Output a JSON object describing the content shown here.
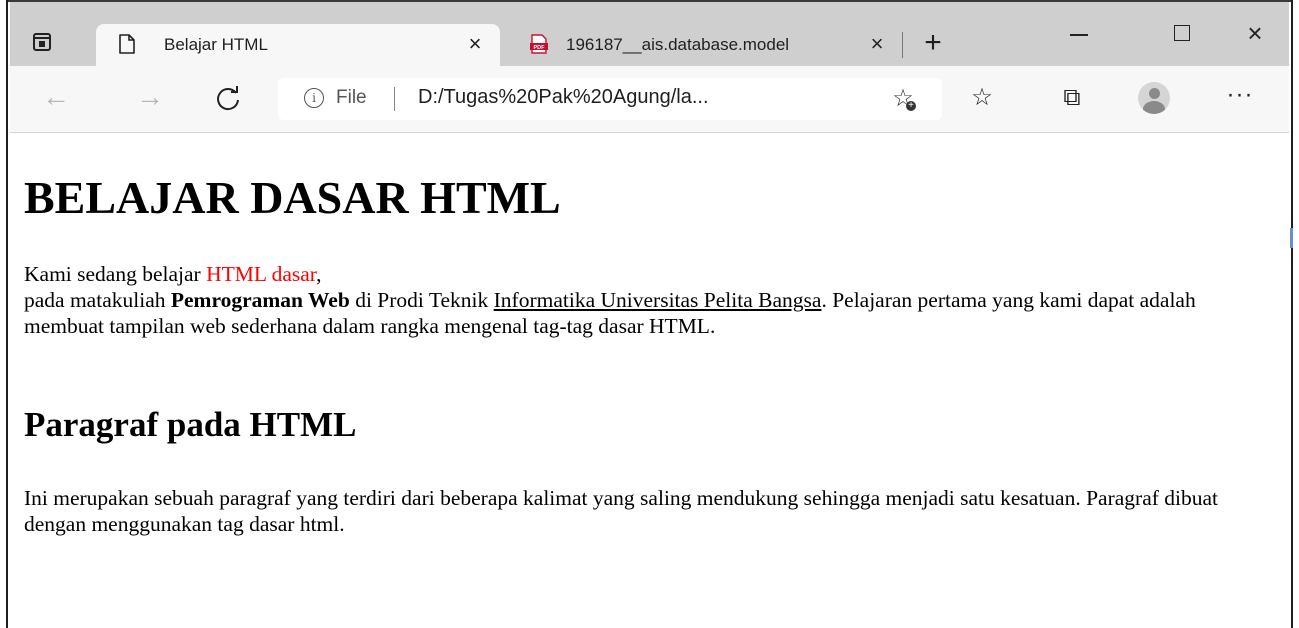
{
  "browser": {
    "tabs": [
      {
        "title": "Belajar HTML",
        "active": true,
        "icon": "page-icon"
      },
      {
        "title": "196187__ais.database.model",
        "active": false,
        "icon": "pdf-icon"
      }
    ],
    "tab_close_glyph": "×",
    "new_tab_glyph": "+",
    "window_close_glyph": "×",
    "address": {
      "info_glyph": "i",
      "scheme_label": "File",
      "url": "D:/Tugas%20Pak%20Agung/la..."
    },
    "nav": {
      "back": "←",
      "forward": "→",
      "reload": "C"
    },
    "toolbar": {
      "favorites_glyph": "☆",
      "collections_glyph": "⧉",
      "more_glyph": "···"
    }
  },
  "page": {
    "heading": "BELAJAR DASAR HTML",
    "intro": {
      "line1_prefix": "Kami sedang belajar ",
      "line1_highlight": "HTML dasar",
      "line1_suffix": ",",
      "line2_prefix": "pada matakuliah ",
      "line2_bold": "Pemrograman Web",
      "line2_middle": " di Prodi Teknik ",
      "line2_underline": "Informatika Universitas Pelita Bangsa",
      "line2_suffix": ". Pelajaran pertama yang kami dapat adalah membuat tampilan web sederhana dalam rangka mengenal tag-tag dasar HTML."
    },
    "subheading": "Paragraf pada HTML",
    "paragraph": "Ini merupakan sebuah paragraf yang terdiri dari beberapa kalimat yang saling mendukung sehingga menjadi satu kesatuan. Paragraf dibuat dengan menggunakan tag dasar html."
  },
  "colors": {
    "highlight": "#ff0000",
    "tabstrip": "#cfcfcf",
    "toolbar": "#f7f7f7"
  }
}
